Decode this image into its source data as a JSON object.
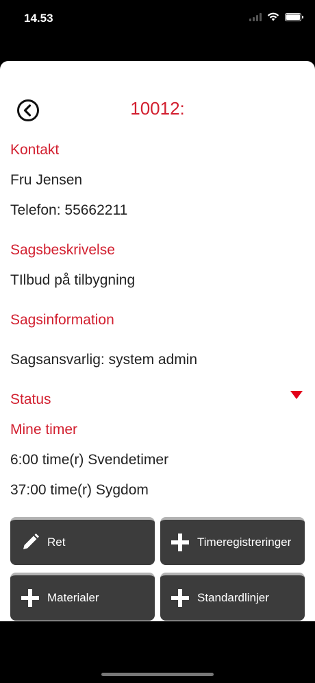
{
  "status_bar": {
    "time": "14.53"
  },
  "header": {
    "title": "10012:"
  },
  "contact": {
    "heading": "Kontakt",
    "name": "Fru Jensen",
    "phone": "Telefon: 55662211"
  },
  "description": {
    "heading": "Sagsbeskrivelse",
    "text": "TIlbud på tilbygning"
  },
  "case_info": {
    "heading": "Sagsinformation",
    "responsible": "Sagsansvarlig:  system admin"
  },
  "status": {
    "heading": "Status"
  },
  "my_hours": {
    "heading": "Mine timer",
    "entries": [
      "6:00 time(r) Svendetimer",
      "37:00 time(r) Sygdom"
    ]
  },
  "buttons": {
    "edit": "Ret",
    "time_registrations": "Timeregistreringer",
    "materials": "Materialer",
    "standard_lines": "Standardlinjer"
  },
  "colors": {
    "accent": "#d21f2f",
    "button_bg": "#3c3c3c"
  }
}
